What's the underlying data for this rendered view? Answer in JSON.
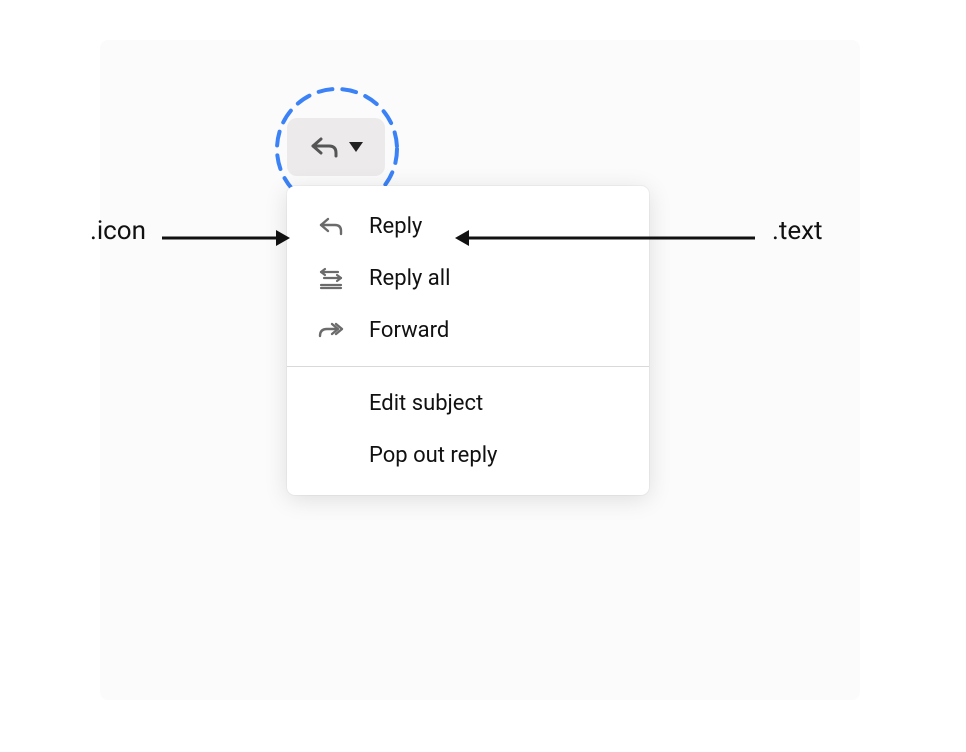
{
  "annotations": {
    "icon_label": ".icon",
    "text_label": ".text"
  },
  "menu": {
    "items": [
      {
        "label": "Reply"
      },
      {
        "label": "Reply all"
      },
      {
        "label": "Forward"
      },
      {
        "label": "Edit subject"
      },
      {
        "label": "Pop out reply"
      }
    ]
  }
}
